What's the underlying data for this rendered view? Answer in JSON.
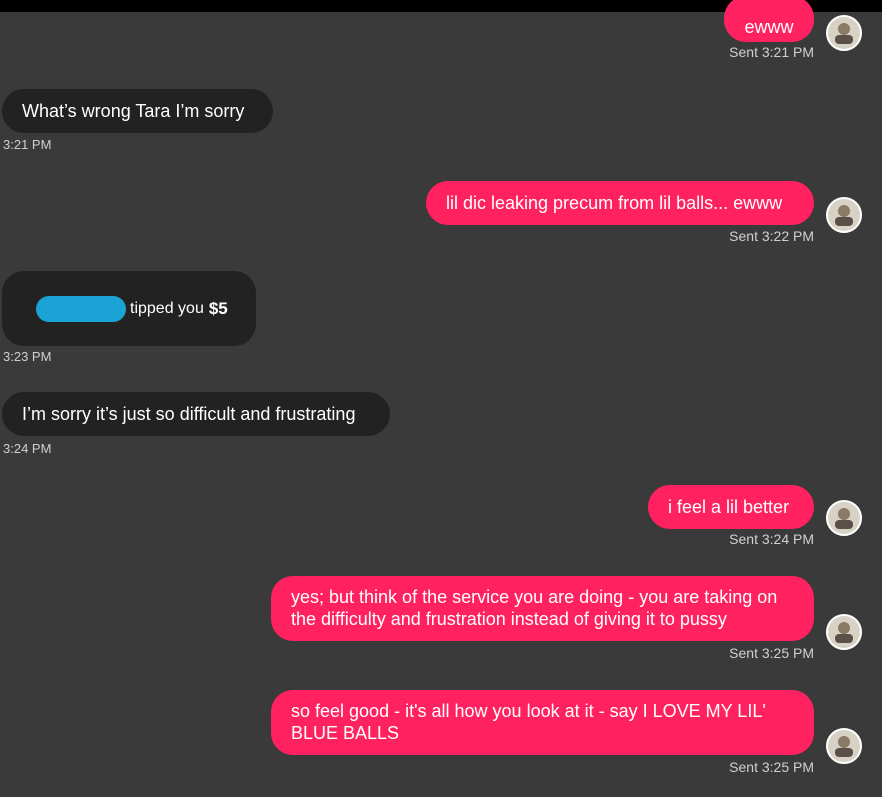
{
  "messages": {
    "m1": {
      "text": "ewww",
      "time": "Sent 3:21 PM"
    },
    "m2": {
      "text": "What’s wrong Tara I’m sorry",
      "time": "3:21 PM"
    },
    "m3": {
      "text": "lil dic leaking precum from lil balls... ewww",
      "time": "Sent 3:22 PM"
    },
    "m4": {
      "tip_text": "tipped you",
      "amount": "$5",
      "time": "3:23 PM"
    },
    "m5": {
      "text": "I’m sorry it’s just so difficult and frustrating",
      "time": "3:24 PM"
    },
    "m6": {
      "text": "i feel a lil better",
      "time": "Sent 3:24 PM"
    },
    "m7": {
      "text": "yes; but think of the service you are doing - you are taking on the difficulty and frustration instead of giving it to pussy",
      "time": "Sent 3:25 PM"
    },
    "m8": {
      "text": "so feel good - it's all how you look at it - say I LOVE MY LIL' BLUE BALLS",
      "time": "Sent 3:25 PM"
    }
  },
  "colors": {
    "background": "#3a3a3a",
    "sent_bubble": "#ff2160",
    "received_bubble": "#222222",
    "timestamp": "#d0d0d0",
    "redaction": "#1aa3d4"
  },
  "icons": {
    "avatar": "user-avatar-icon"
  }
}
